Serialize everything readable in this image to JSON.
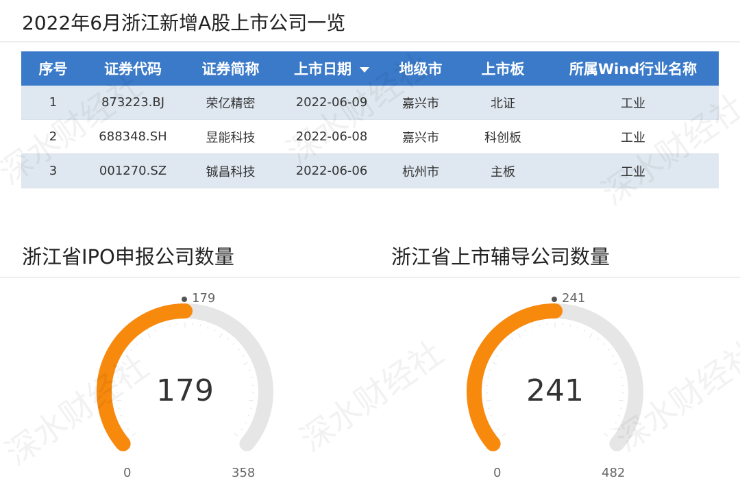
{
  "table_title": "2022年6月浙江新增A股上市公司一览",
  "table": {
    "columns": [
      "序号",
      "证券代码",
      "证券简称",
      "上市日期",
      "地级市",
      "上市板",
      "所属Wind行业名称"
    ],
    "rows": [
      [
        "1",
        "873223.BJ",
        "荣亿精密",
        "2022-06-09",
        "嘉兴市",
        "北证",
        "工业"
      ],
      [
        "2",
        "688348.SH",
        "昱能科技",
        "2022-06-08",
        "嘉兴市",
        "科创板",
        "工业"
      ],
      [
        "3",
        "001270.SZ",
        "铖昌科技",
        "2022-06-06",
        "杭州市",
        "主板",
        "工业"
      ]
    ]
  },
  "watermark": "深水财经社",
  "colors": {
    "header": "#3a7ac9",
    "gauge_fill": "#f7890d",
    "gauge_track": "#e6e6e6"
  },
  "chart_data": [
    {
      "type": "gauge",
      "title": "浙江省IPO申报公司数量",
      "value": 179,
      "min": 0,
      "max": 358,
      "value_label": "179",
      "min_label": "0",
      "max_label": "358"
    },
    {
      "type": "gauge",
      "title": "浙江省上市辅导公司数量",
      "value": 241,
      "min": 0,
      "max": 482,
      "value_label": "241",
      "min_label": "0",
      "max_label": "482"
    }
  ]
}
